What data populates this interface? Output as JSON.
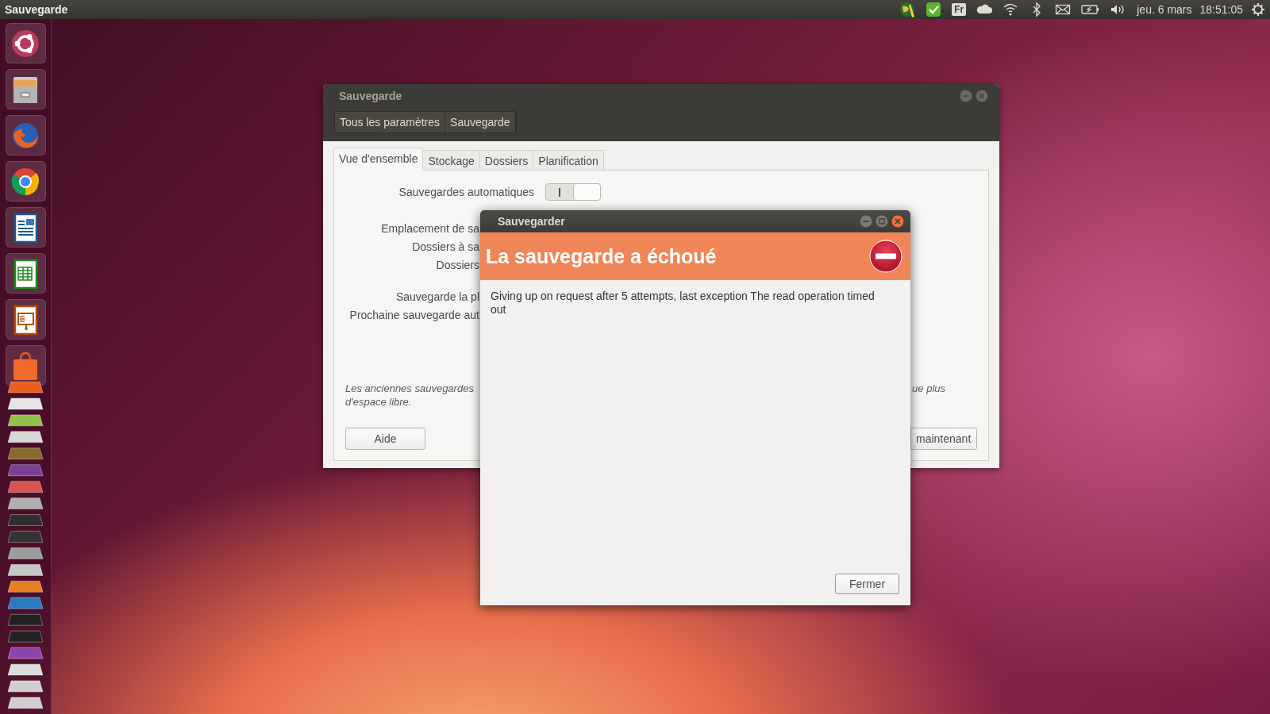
{
  "top_panel": {
    "app_title": "Sauvegarde",
    "indicators": [
      {
        "kind": "globe"
      },
      {
        "kind": "check"
      },
      {
        "kind": "keyboard",
        "label": "Fr"
      },
      {
        "kind": "cloud"
      },
      {
        "kind": "wifi"
      },
      {
        "kind": "bluetooth"
      },
      {
        "kind": "mail"
      },
      {
        "kind": "battery"
      },
      {
        "kind": "sound"
      }
    ],
    "date": "jeu. 6 mars",
    "time": "18:51:05"
  },
  "launcher": {
    "items": [
      {
        "kind": "ubuntu"
      },
      {
        "kind": "files"
      },
      {
        "kind": "firefox"
      },
      {
        "kind": "chrome"
      },
      {
        "kind": "writer"
      },
      {
        "kind": "calc"
      },
      {
        "kind": "impress"
      },
      {
        "kind": "store"
      }
    ]
  },
  "settings_window": {
    "title": "Sauvegarde",
    "breadcrumbs": [
      "Tous les paramètres",
      "Sauvegarde"
    ],
    "tabs": [
      {
        "label": "Vue d'ensemble",
        "selected": true
      },
      {
        "label": "Stockage",
        "selected": false
      },
      {
        "label": "Dossiers",
        "selected": false
      },
      {
        "label": "Planification",
        "selected": false
      }
    ],
    "automatic_backups": {
      "label": "Sauvegardes automatiques",
      "on": true
    },
    "info_rows": [
      [
        "Emplacement de sa",
        "Dossiers à sa",
        "Dossiers"
      ],
      [
        "Sauvegarde la pl",
        "Prochaine sauvegarde aut"
      ]
    ],
    "note": {
      "lines": [
        "Les anciennes sauvegardes",
        "d'espace libre."
      ],
      "tail": "ue plus"
    },
    "help_button": "Aide",
    "backup_button": "maintenant"
  },
  "error_dialog": {
    "title": "Sauvegarder",
    "heading": "La sauvegarde a échoué",
    "message": "Giving up on request after 5 attempts, last exception The read operation timed out",
    "close_button": "Fermer"
  }
}
